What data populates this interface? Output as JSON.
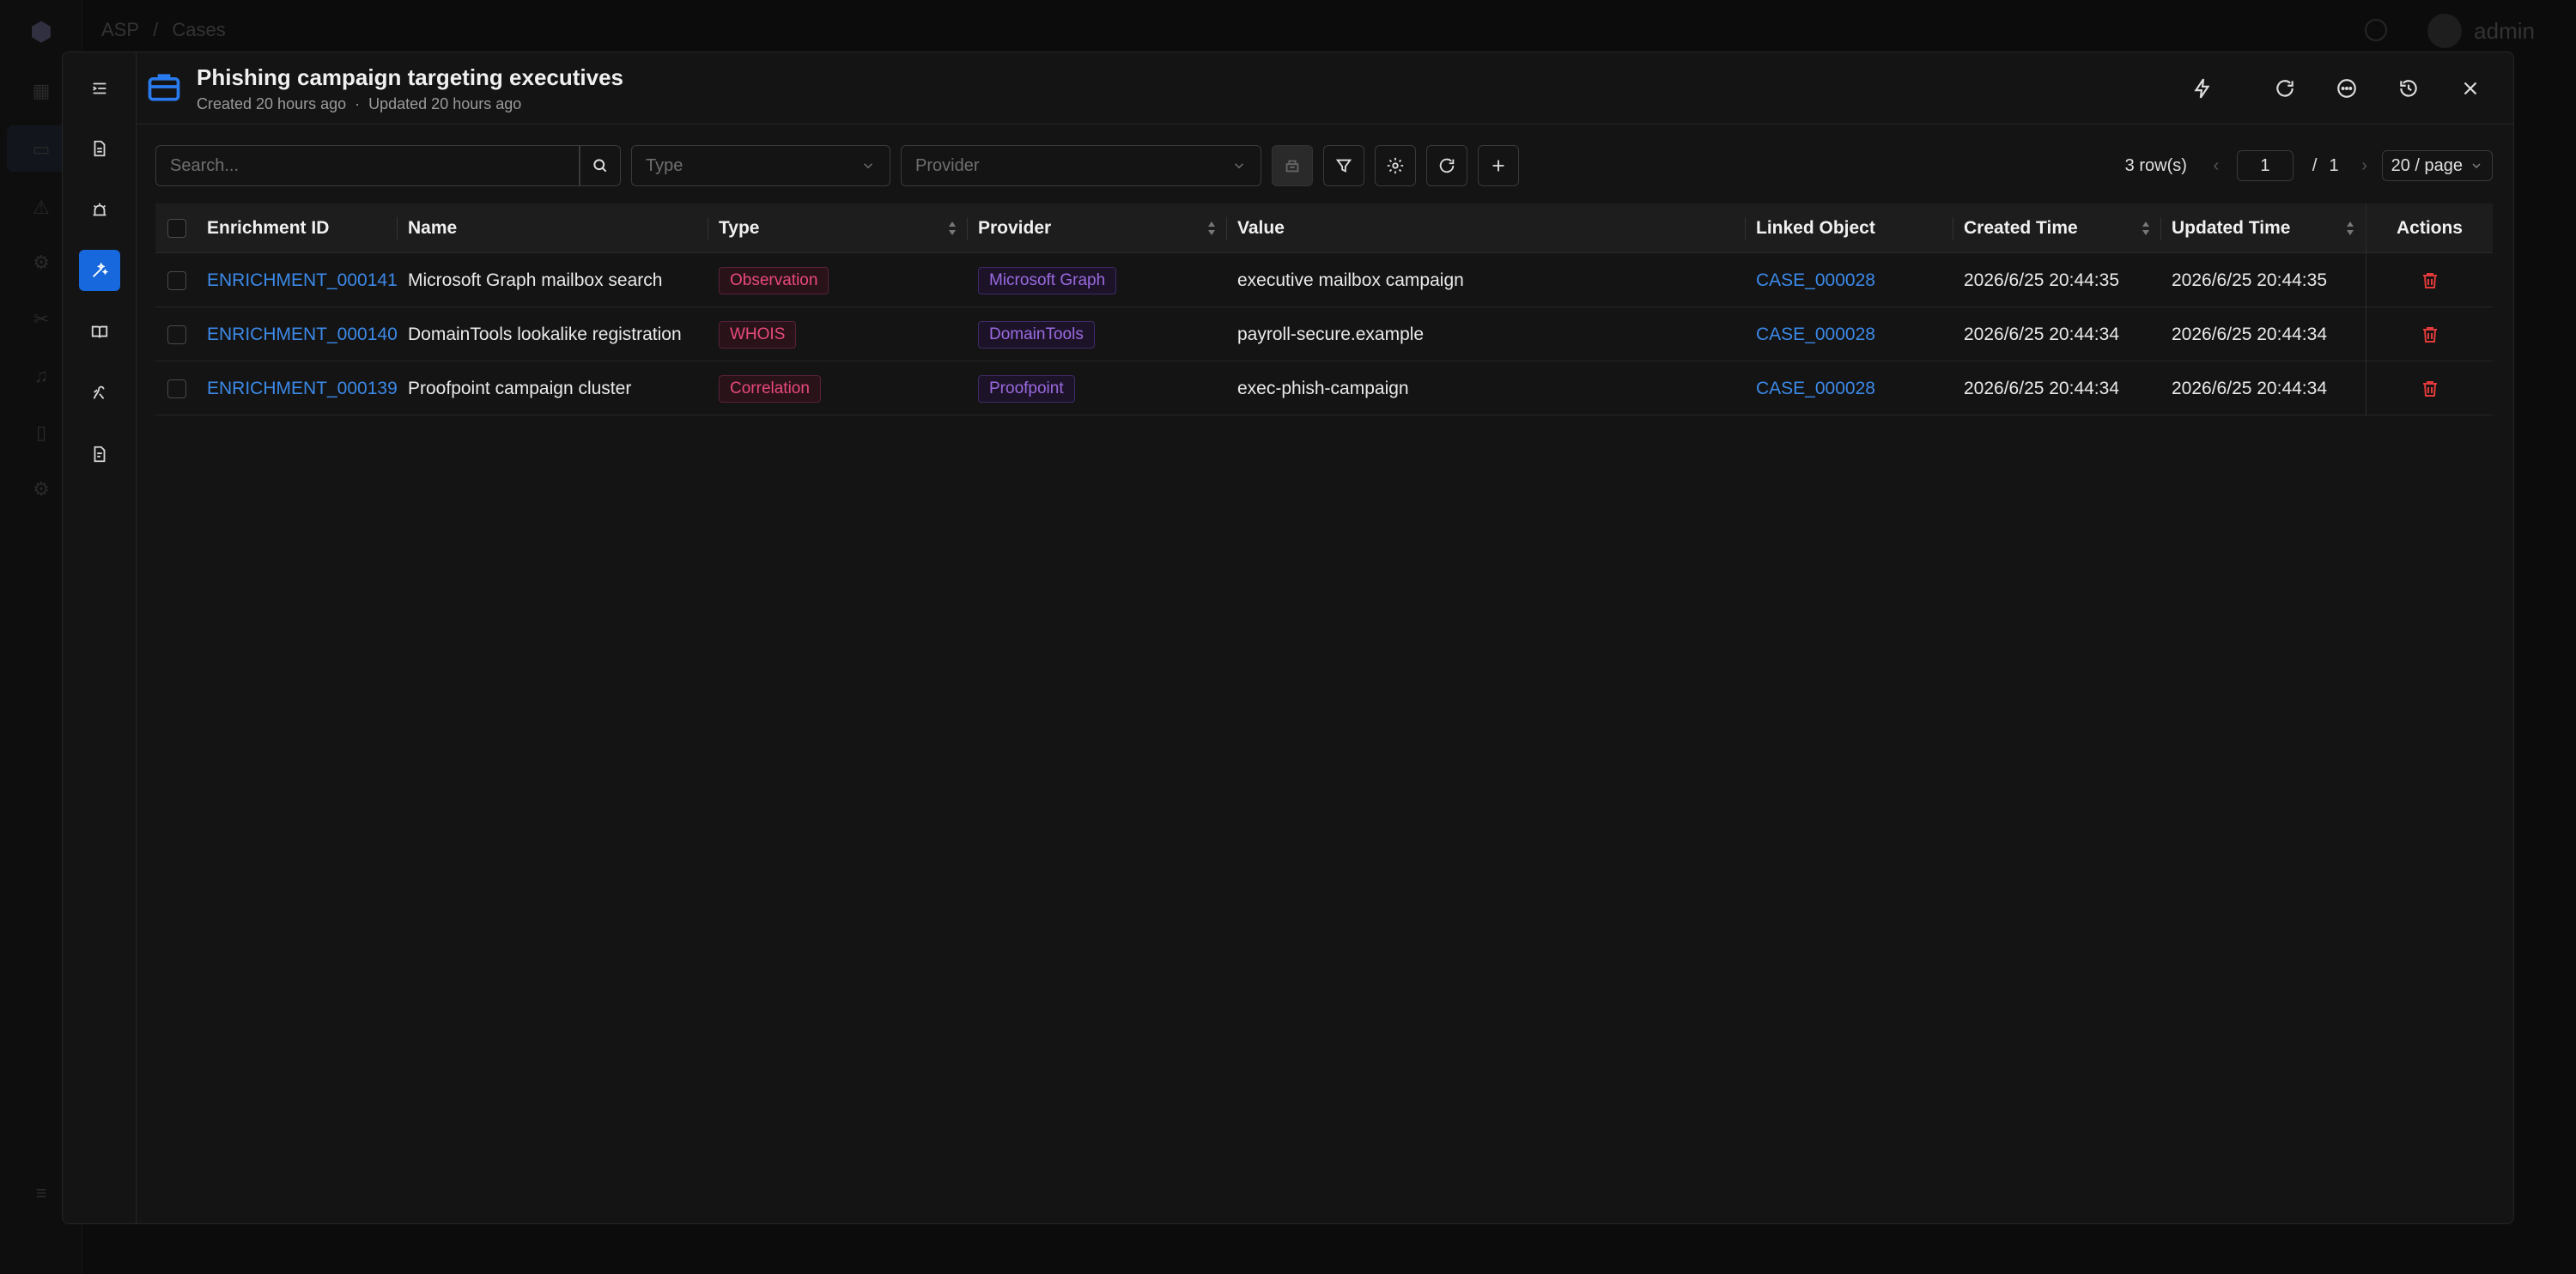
{
  "background": {
    "breadcrumb": [
      "ASP",
      "/",
      "Cases"
    ],
    "user": "admin"
  },
  "case": {
    "title": "Phishing campaign targeting executives",
    "created": "Created 20 hours ago",
    "dot": "·",
    "updated": "Updated 20 hours ago"
  },
  "rail": {
    "items": [
      {
        "name": "collapse-menu-icon"
      },
      {
        "name": "document-icon"
      },
      {
        "name": "alert-icon"
      },
      {
        "name": "enrichment-icon",
        "active": true
      },
      {
        "name": "book-icon"
      },
      {
        "name": "playbook-icon"
      },
      {
        "name": "report-icon"
      }
    ]
  },
  "header_actions": [
    "lightning-icon",
    "refresh-icon",
    "chat-icon",
    "history-icon",
    "close-icon"
  ],
  "toolbar": {
    "search_placeholder": "Search...",
    "type_placeholder": "Type",
    "provider_placeholder": "Provider"
  },
  "pager": {
    "rows": "3 row(s)",
    "page": "1",
    "slash": "/",
    "total_pages": "1",
    "per_page": "20 / page"
  },
  "table": {
    "columns": [
      "Enrichment ID",
      "Name",
      "Type",
      "Provider",
      "Value",
      "Linked Object",
      "Created Time",
      "Updated Time",
      "Actions"
    ],
    "rows": [
      {
        "id": "ENRICHMENT_000141",
        "name": "Microsoft Graph mailbox search",
        "type": "Observation",
        "provider": "Microsoft Graph",
        "value": "executive mailbox campaign",
        "linked": "CASE_000028",
        "created": "2026/6/25 20:44:35",
        "updated": "2026/6/25 20:44:35"
      },
      {
        "id": "ENRICHMENT_000140",
        "name": "DomainTools lookalike registration",
        "type": "WHOIS",
        "provider": "DomainTools",
        "value": "payroll-secure.example",
        "linked": "CASE_000028",
        "created": "2026/6/25 20:44:34",
        "updated": "2026/6/25 20:44:34"
      },
      {
        "id": "ENRICHMENT_000139",
        "name": "Proofpoint campaign cluster",
        "type": "Correlation",
        "provider": "Proofpoint",
        "value": "exec-phish-campaign",
        "linked": "CASE_000028",
        "created": "2026/6/25 20:44:34",
        "updated": "2026/6/25 20:44:34"
      }
    ]
  },
  "colors": {
    "accent": "#1668dc",
    "link": "#3c89e8",
    "type_tag": "#e84a7a",
    "provider_tag": "#9a6ae0",
    "delete": "#e23a3a"
  }
}
